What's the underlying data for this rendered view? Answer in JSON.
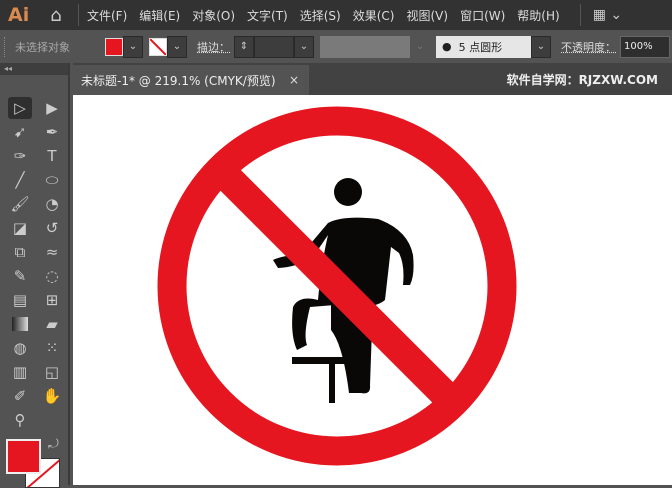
{
  "app": {
    "logo": "Ai"
  },
  "menu": [
    "文件(F)",
    "编辑(E)",
    "对象(O)",
    "文字(T)",
    "选择(S)",
    "效果(C)",
    "视图(V)",
    "窗口(W)",
    "帮助(H)"
  ],
  "control": {
    "selection": "未选择对象",
    "stroke_label": "描边：",
    "brush": "5 点圆形",
    "opacity_label": "不透明度：",
    "opacity": "100%"
  },
  "document": {
    "tab_title": "未标题-1* @ 219.1% (CMYK/预览)",
    "close": "×"
  },
  "watermark": "软件自学网：RJZXW.COM",
  "colors": {
    "fill": "#e5161f",
    "sign_red": "#e5161f",
    "figure": "#0a0707"
  }
}
